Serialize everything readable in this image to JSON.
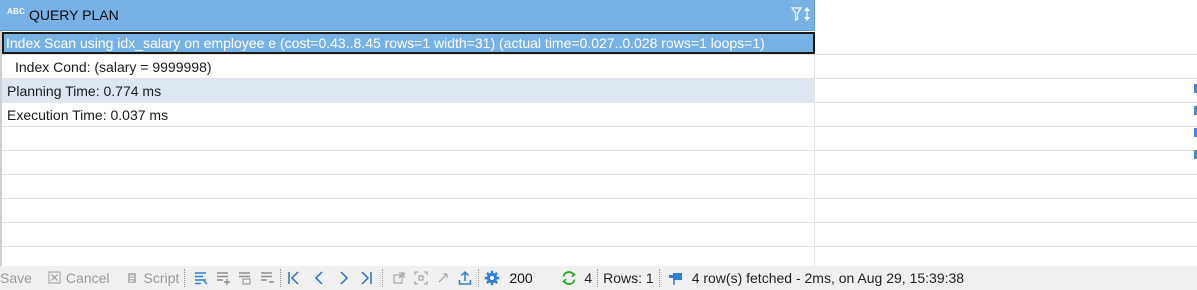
{
  "grid": {
    "column_header": {
      "type_icon": "ABC",
      "title": "QUERY PLAN"
    },
    "rows": [
      {
        "text": "Index Scan using idx_salary on employee e  (cost=0.43..8.45 rows=1 width=31) (actual time=0.027..0.028 rows=1 loops=1)",
        "selected": true
      },
      {
        "text": "Index Cond: (salary = 9999998)",
        "indent": true
      },
      {
        "text": "Planning Time: 0.774 ms",
        "alt": true
      },
      {
        "text": "Execution Time: 0.037 ms"
      }
    ]
  },
  "statusbar": {
    "save_label": "Save",
    "cancel_label": "Cancel",
    "script_label": "Script",
    "fetch_size": "200",
    "refresh_count": "4",
    "rows_label": "Rows: 1",
    "fetched_text": "4 row(s) fetched - 2ms, on Aug 29, 15:39:38"
  },
  "colors": {
    "header_bg": "#77b1e6",
    "selected_bg": "#76b2e6",
    "alt_row_bg": "#dde7f2",
    "accent_blue": "#2f7fd3",
    "refresh_green": "#2aa52a"
  }
}
